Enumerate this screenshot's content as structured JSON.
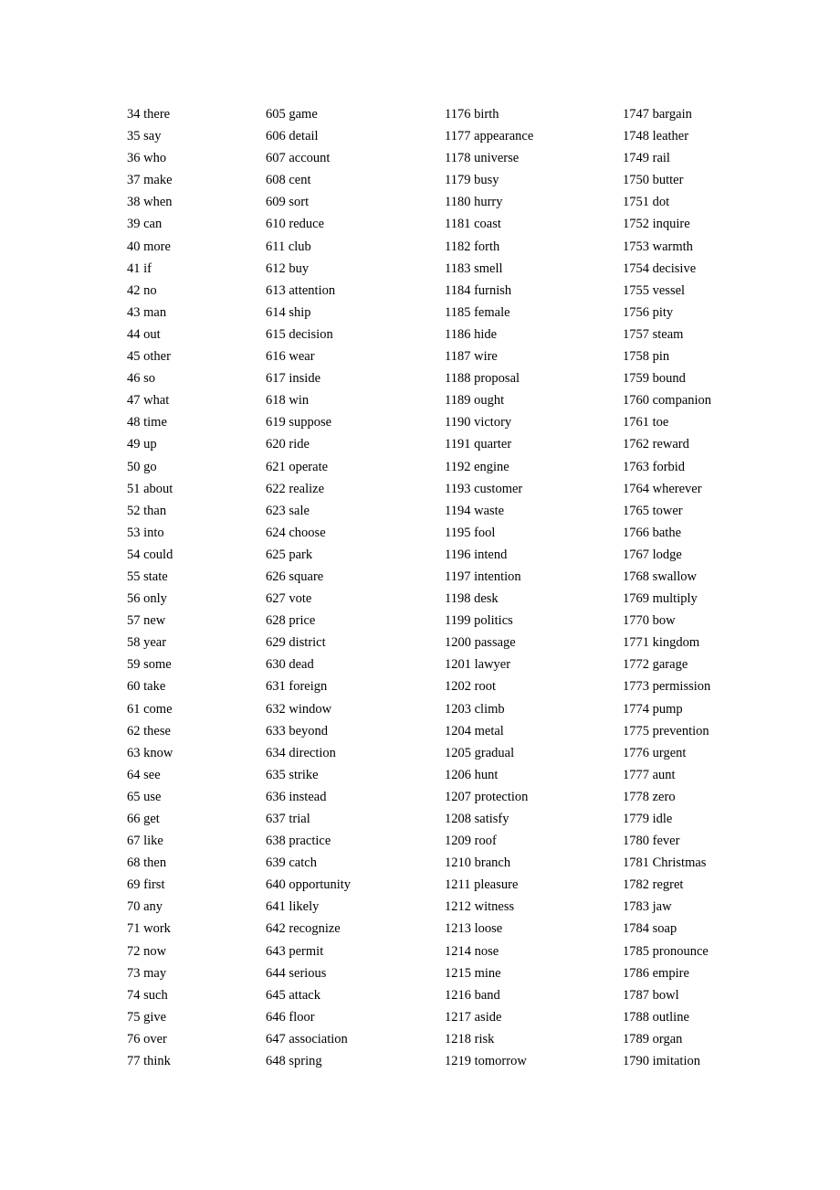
{
  "document": {
    "columns": [
      {
        "entries": [
          {
            "n": "34",
            "word": "there"
          },
          {
            "n": "35",
            "word": "say"
          },
          {
            "n": "36",
            "word": "who"
          },
          {
            "n": "37",
            "word": "make"
          },
          {
            "n": "38",
            "word": "when"
          },
          {
            "n": "39",
            "word": "can"
          },
          {
            "n": "40",
            "word": "more"
          },
          {
            "n": "41",
            "word": "if"
          },
          {
            "n": "42",
            "word": "no"
          },
          {
            "n": "43",
            "word": "man"
          },
          {
            "n": "44",
            "word": "out"
          },
          {
            "n": "45",
            "word": "other"
          },
          {
            "n": "46",
            "word": "so"
          },
          {
            "n": "47",
            "word": "what"
          },
          {
            "n": "48",
            "word": "time"
          },
          {
            "n": "49",
            "word": "up"
          },
          {
            "n": "50",
            "word": "go"
          },
          {
            "n": "51",
            "word": "about"
          },
          {
            "n": "52",
            "word": "than"
          },
          {
            "n": "53",
            "word": "into"
          },
          {
            "n": "54",
            "word": "could"
          },
          {
            "n": "55",
            "word": "state"
          },
          {
            "n": "56",
            "word": "only"
          },
          {
            "n": "57",
            "word": "new"
          },
          {
            "n": "58",
            "word": "year"
          },
          {
            "n": "59",
            "word": "some"
          },
          {
            "n": "60",
            "word": "take"
          },
          {
            "n": "61",
            "word": "come"
          },
          {
            "n": "62",
            "word": "these"
          },
          {
            "n": "63",
            "word": "know"
          },
          {
            "n": "64",
            "word": "see"
          },
          {
            "n": "65",
            "word": "use"
          },
          {
            "n": "66",
            "word": "get"
          },
          {
            "n": "67",
            "word": "like"
          },
          {
            "n": "68",
            "word": "then"
          },
          {
            "n": "69",
            "word": "first"
          },
          {
            "n": "70",
            "word": "any"
          },
          {
            "n": "71",
            "word": "work"
          },
          {
            "n": "72",
            "word": "now"
          },
          {
            "n": "73",
            "word": "may"
          },
          {
            "n": "74",
            "word": "such"
          },
          {
            "n": "75",
            "word": "give"
          },
          {
            "n": "76",
            "word": "over"
          },
          {
            "n": "77",
            "word": "think"
          }
        ]
      },
      {
        "entries": [
          {
            "n": "605",
            "word": "game"
          },
          {
            "n": "606",
            "word": "detail"
          },
          {
            "n": "607",
            "word": "account"
          },
          {
            "n": "608",
            "word": "cent"
          },
          {
            "n": "609",
            "word": "sort"
          },
          {
            "n": "610",
            "word": "reduce"
          },
          {
            "n": "611",
            "word": "club"
          },
          {
            "n": "612",
            "word": "buy"
          },
          {
            "n": "613",
            "word": "attention"
          },
          {
            "n": "614",
            "word": "ship"
          },
          {
            "n": "615",
            "word": "decision"
          },
          {
            "n": "616",
            "word": "wear"
          },
          {
            "n": "617",
            "word": "inside"
          },
          {
            "n": "618",
            "word": "win"
          },
          {
            "n": "619",
            "word": "suppose"
          },
          {
            "n": "620",
            "word": "ride"
          },
          {
            "n": "621",
            "word": "operate"
          },
          {
            "n": "622",
            "word": "realize"
          },
          {
            "n": "623",
            "word": "sale"
          },
          {
            "n": "624",
            "word": "choose"
          },
          {
            "n": "625",
            "word": "park"
          },
          {
            "n": "626",
            "word": "square"
          },
          {
            "n": "627",
            "word": "vote"
          },
          {
            "n": "628",
            "word": "price"
          },
          {
            "n": "629",
            "word": "district"
          },
          {
            "n": "630",
            "word": "dead"
          },
          {
            "n": "631",
            "word": "foreign"
          },
          {
            "n": "632",
            "word": "window"
          },
          {
            "n": "633",
            "word": "beyond"
          },
          {
            "n": "634",
            "word": "direction"
          },
          {
            "n": "635",
            "word": "strike"
          },
          {
            "n": "636",
            "word": "instead"
          },
          {
            "n": "637",
            "word": "trial"
          },
          {
            "n": "638",
            "word": "practice"
          },
          {
            "n": "639",
            "word": "catch"
          },
          {
            "n": "640",
            "word": "opportunity"
          },
          {
            "n": "641",
            "word": "likely"
          },
          {
            "n": "642",
            "word": "recognize"
          },
          {
            "n": "643",
            "word": "permit"
          },
          {
            "n": "644",
            "word": "serious"
          },
          {
            "n": "645",
            "word": "attack"
          },
          {
            "n": "646",
            "word": "floor"
          },
          {
            "n": "647",
            "word": "association"
          },
          {
            "n": "648",
            "word": "spring"
          }
        ]
      },
      {
        "entries": [
          {
            "n": "1176",
            "word": "birth"
          },
          {
            "n": "1177",
            "word": "appearance"
          },
          {
            "n": "1178",
            "word": "universe"
          },
          {
            "n": "1179",
            "word": "busy"
          },
          {
            "n": "1180",
            "word": "hurry"
          },
          {
            "n": "1181",
            "word": "coast"
          },
          {
            "n": "1182",
            "word": "forth"
          },
          {
            "n": "1183",
            "word": "smell"
          },
          {
            "n": "1184",
            "word": "furnish"
          },
          {
            "n": "1185",
            "word": "female"
          },
          {
            "n": "1186",
            "word": "hide"
          },
          {
            "n": "1187",
            "word": "wire"
          },
          {
            "n": "1188",
            "word": "proposal"
          },
          {
            "n": "1189",
            "word": "ought"
          },
          {
            "n": "1190",
            "word": "victory"
          },
          {
            "n": "1191",
            "word": "quarter"
          },
          {
            "n": "1192",
            "word": "engine"
          },
          {
            "n": "1193",
            "word": "customer"
          },
          {
            "n": "1194",
            "word": "waste"
          },
          {
            "n": "1195",
            "word": "fool"
          },
          {
            "n": "1196",
            "word": "intend"
          },
          {
            "n": "1197",
            "word": "intention"
          },
          {
            "n": "1198",
            "word": "desk"
          },
          {
            "n": "1199",
            "word": "politics"
          },
          {
            "n": "1200",
            "word": "passage"
          },
          {
            "n": "1201",
            "word": "lawyer"
          },
          {
            "n": "1202",
            "word": "root"
          },
          {
            "n": "1203",
            "word": "climb"
          },
          {
            "n": "1204",
            "word": "metal"
          },
          {
            "n": "1205",
            "word": "gradual"
          },
          {
            "n": "1206",
            "word": "hunt"
          },
          {
            "n": "1207",
            "word": "protection"
          },
          {
            "n": "1208",
            "word": "satisfy"
          },
          {
            "n": "1209",
            "word": "roof"
          },
          {
            "n": "1210",
            "word": "branch"
          },
          {
            "n": "1211",
            "word": "pleasure"
          },
          {
            "n": "1212",
            "word": "witness"
          },
          {
            "n": "1213",
            "word": "loose"
          },
          {
            "n": "1214",
            "word": "nose"
          },
          {
            "n": "1215",
            "word": "mine"
          },
          {
            "n": "1216",
            "word": "band"
          },
          {
            "n": "1217",
            "word": "aside"
          },
          {
            "n": "1218",
            "word": "risk"
          },
          {
            "n": "1219",
            "word": "tomorrow"
          }
        ]
      },
      {
        "entries": [
          {
            "n": "1747",
            "word": "bargain"
          },
          {
            "n": "1748",
            "word": "leather"
          },
          {
            "n": "1749",
            "word": "rail"
          },
          {
            "n": "1750",
            "word": "butter"
          },
          {
            "n": "1751",
            "word": "dot"
          },
          {
            "n": "1752",
            "word": "inquire"
          },
          {
            "n": "1753",
            "word": "warmth"
          },
          {
            "n": "1754",
            "word": "decisive"
          },
          {
            "n": "1755",
            "word": "vessel"
          },
          {
            "n": "1756",
            "word": "pity"
          },
          {
            "n": "1757",
            "word": "steam"
          },
          {
            "n": "1758",
            "word": "pin"
          },
          {
            "n": "1759",
            "word": "bound"
          },
          {
            "n": "1760",
            "word": "companion"
          },
          {
            "n": "1761",
            "word": "toe"
          },
          {
            "n": "1762",
            "word": "reward"
          },
          {
            "n": "1763",
            "word": "forbid"
          },
          {
            "n": "1764",
            "word": "wherever"
          },
          {
            "n": "1765",
            "word": "tower"
          },
          {
            "n": "1766",
            "word": "bathe"
          },
          {
            "n": "1767",
            "word": "lodge"
          },
          {
            "n": "1768",
            "word": "swallow"
          },
          {
            "n": "1769",
            "word": "multiply"
          },
          {
            "n": "1770",
            "word": "bow"
          },
          {
            "n": "1771",
            "word": "kingdom"
          },
          {
            "n": "1772",
            "word": "garage"
          },
          {
            "n": "1773",
            "word": "permission"
          },
          {
            "n": "1774",
            "word": "pump"
          },
          {
            "n": "1775",
            "word": "prevention"
          },
          {
            "n": "1776",
            "word": "urgent"
          },
          {
            "n": "1777",
            "word": "aunt"
          },
          {
            "n": "1778",
            "word": "zero"
          },
          {
            "n": "1779",
            "word": "idle"
          },
          {
            "n": "1780",
            "word": "fever"
          },
          {
            "n": "1781",
            "word": "Christmas"
          },
          {
            "n": "1782",
            "word": "regret"
          },
          {
            "n": "1783",
            "word": "jaw"
          },
          {
            "n": "1784",
            "word": "soap"
          },
          {
            "n": "1785",
            "word": "pronounce"
          },
          {
            "n": "1786",
            "word": "empire"
          },
          {
            "n": "1787",
            "word": "bowl"
          },
          {
            "n": "1788",
            "word": "outline"
          },
          {
            "n": "1789",
            "word": "organ"
          },
          {
            "n": "1790",
            "word": "imitation"
          }
        ]
      }
    ]
  }
}
